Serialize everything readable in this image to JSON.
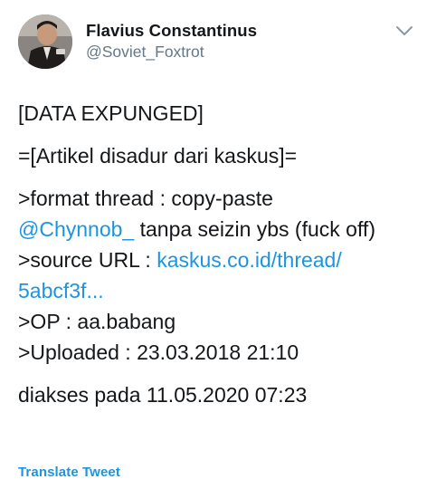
{
  "author": {
    "display_name": "Flavius Constantinus",
    "handle": "@Soviet_Foxtrot"
  },
  "icons": {
    "avatar": "profile-photo",
    "menu": "chevron-down-icon"
  },
  "colors": {
    "link": "#1b95e0",
    "text": "#14171a",
    "muted": "#657786"
  },
  "tweet": {
    "line1": "[DATA EXPUNGED]",
    "line2": "=[Artikel disadur dari kaskus]=",
    "format_line": ">format thread : copy-paste",
    "mention": "@Chynnob_",
    "mention_tail": " tanpa seizin ybs (fuck off)",
    "source_prefix": ">source URL : ",
    "source_link_part1": "kaskus.co.id/thread/",
    "source_link_part2": "5abcf3f...",
    "op_line": ">OP : aa.babang",
    "uploaded_line": ">Uploaded : 23.03.2018 21:10",
    "accessed_line": "diakses pada 11.05.2020 07:23"
  },
  "actions": {
    "translate_label": "Translate Tweet"
  }
}
